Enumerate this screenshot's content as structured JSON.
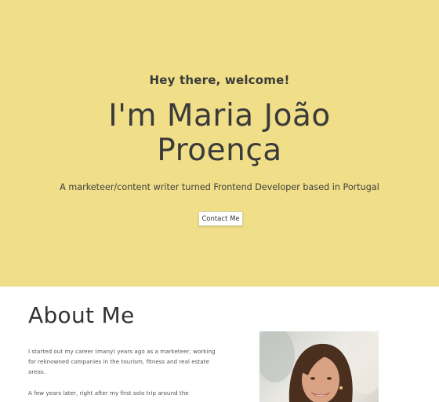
{
  "hero": {
    "greeting": "Hey there, welcome!",
    "name_line1": "I'm Maria João",
    "name_line2": "Proença",
    "tagline": "A marketeer/content writer turned Frontend Developer based in Portugal",
    "contact_label": "Contact Me",
    "background_color": "#f0df88"
  },
  "about": {
    "title": "About Me",
    "paragraphs": [
      "I started out my career (many) years ago as a marketeer, working for reknowned companies in the tourism, fitness and real estate areas.",
      "A few years later, right after my first solo trip around the"
    ]
  }
}
